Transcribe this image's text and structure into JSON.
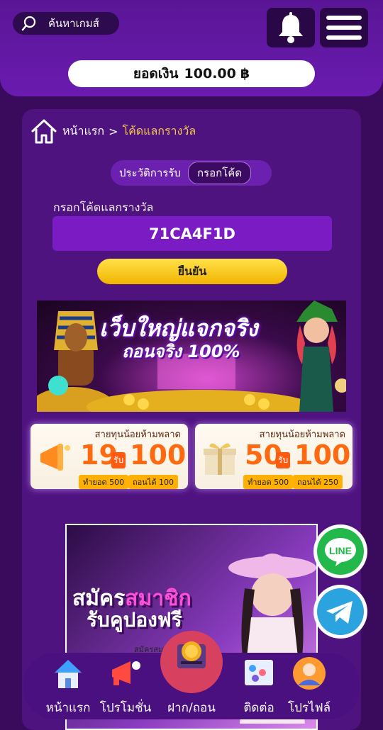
{
  "header": {
    "search_label": "ค้นหาเกมส์",
    "balance_label": "ยอดเงิน",
    "balance_value": "100.00",
    "currency_symbol": "฿"
  },
  "breadcrumb": {
    "home": "หน้าแรก",
    "separator": ">",
    "current": "โค้ดแลกรางวัล"
  },
  "tabs": {
    "history": "ประวัติการรับ",
    "enter_code": "กรอกโค้ด"
  },
  "form": {
    "label": "กรอกโค้ดแลกรางวัล",
    "code_value": "71CA4F1D",
    "confirm": "ยืนยัน"
  },
  "banners": {
    "banner1_line1": "เว็บใหญ่แจกจริง",
    "banner1_line2": "ถอนจริง 100%",
    "promos": [
      {
        "title": "สายทุนน้อยห้ามพลาด",
        "deposit": "19",
        "get": "รับ",
        "bonus": "100",
        "foot1": "ทำยอด 500",
        "foot2": "ถอนได้ 100"
      },
      {
        "title": "สายทุนน้อยห้ามพลาด",
        "deposit": "50",
        "get": "รับ",
        "bonus": "100",
        "foot1": "ทำยอด 500",
        "foot2": "ถอนได้ 250"
      }
    ],
    "banner2_line1a": "สมัคร",
    "banner2_line1b": "สมาชิก",
    "banner2_line2": "รับคูปองฟรี",
    "banner2_line3": "สมัครสมา"
  },
  "side": {
    "line": "LINE"
  },
  "bottom_nav": [
    {
      "label": "หน้าแรก"
    },
    {
      "label": "โปรโมชั่น"
    },
    {
      "label": "ฝาก/ถอน"
    },
    {
      "label": "ติดต่อ"
    },
    {
      "label": "โปรไฟล์"
    }
  ],
  "colors": {
    "accent": "#f6c945",
    "background": "#3a0b5c",
    "line_green": "#22b84a",
    "telegram_blue": "#2aa3de"
  }
}
